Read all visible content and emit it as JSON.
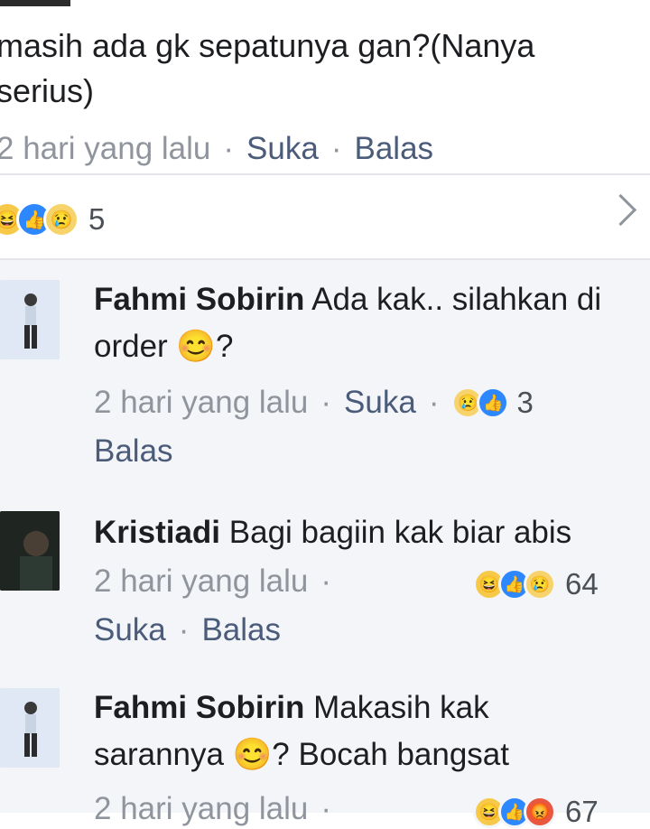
{
  "post": {
    "text": "masih ada gk sepatunya gan?(Nanya serius)",
    "time": "2 hari yang lalu",
    "like": "Suka",
    "reply": "Balas",
    "reactions_count": "5"
  },
  "comments": [
    {
      "name": "Fahmi Sobirin",
      "text": "Ada kak..  silahkan di order 😊?",
      "time": "2 hari yang lalu",
      "like": "Suka",
      "reply": "Balas",
      "reactions_count": "3"
    },
    {
      "name": "Kristiadi",
      "text": "Bagi bagiin kak biar abis",
      "time": "2 hari yang lalu",
      "like": "Suka",
      "reply": "Balas",
      "reactions_count": "64"
    },
    {
      "name": "Fahmi Sobirin",
      "text": "Makasih kak sarannya 😊?  Bocah bangsat",
      "time": "2 hari yang lalu",
      "reactions_count": "67"
    }
  ],
  "colors": {
    "like_blue": "#2d88ff",
    "laugh_yellow": "#f7c948",
    "angry_red": "#e9573f",
    "comment_bg": "#f3f5f8"
  },
  "icons": [
    "laugh-reaction-icon",
    "like-reaction-icon",
    "sad-reaction-icon",
    "angry-reaction-icon",
    "chevron-right-icon"
  ]
}
